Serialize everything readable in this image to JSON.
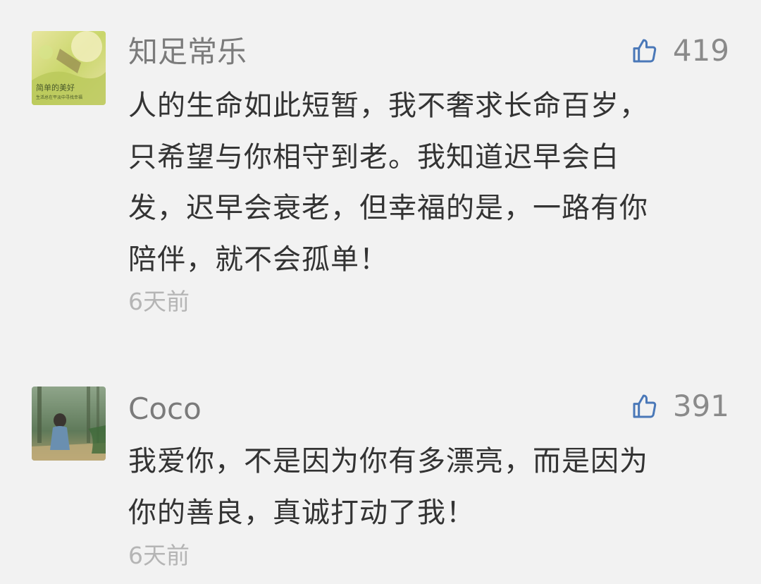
{
  "comments": [
    {
      "username": "知足常乐",
      "likes": "419",
      "like_icon": "thumbs-up-icon",
      "content_lines": [
        "人的生命如此短暂，我不奢求长命百岁，",
        "只希望与你相守到老。我知道迟早会白",
        "发，迟早会衰老，但幸福的是，一路有你",
        "陪伴，就不会孤单！"
      ],
      "time": "6天前",
      "avatar_caption_1": "简单的美好",
      "avatar_caption_2": "生活总在平淡中寻找幸福"
    },
    {
      "username": "Coco",
      "likes": "391",
      "like_icon": "thumbs-up-icon",
      "content_lines": [
        "我爱你，不是因为你有多漂亮，而是因为",
        "你的善良，真诚打动了我！"
      ],
      "time": "6天前"
    }
  ],
  "colors": {
    "background": "#f2f2f2",
    "username": "#7b7b7b",
    "content": "#333333",
    "time": "#b5b5b5",
    "like_icon": "#4a78b8"
  }
}
